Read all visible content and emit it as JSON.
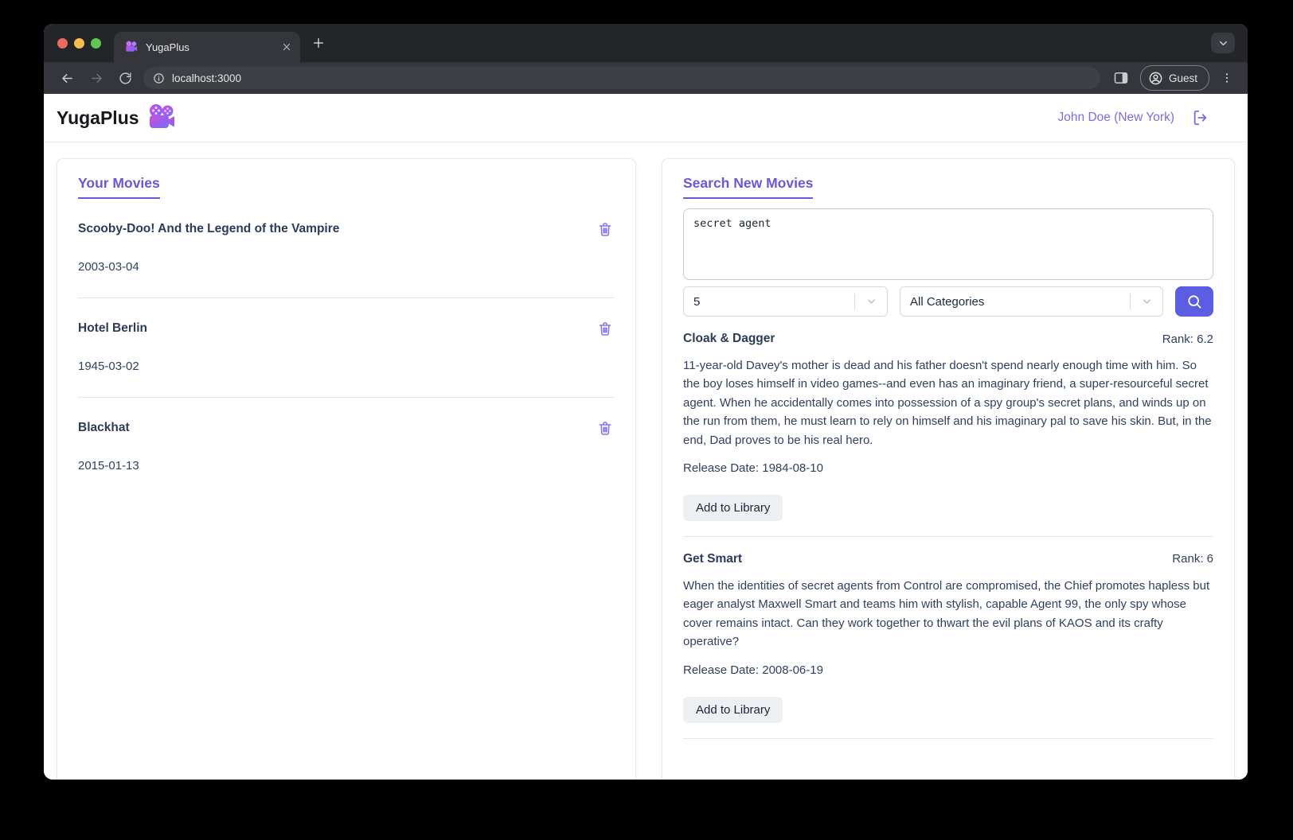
{
  "browser": {
    "tab_title": "YugaPlus",
    "url": "localhost:3000",
    "guest_label": "Guest"
  },
  "header": {
    "brand": "YugaPlus",
    "user": "John Doe (New York)"
  },
  "library": {
    "title": "Your Movies",
    "movies": [
      {
        "title": "Scooby-Doo! And the Legend of the Vampire",
        "date": "2003-03-04"
      },
      {
        "title": "Hotel Berlin",
        "date": "1945-03-02"
      },
      {
        "title": "Blackhat",
        "date": "2015-01-13"
      }
    ]
  },
  "search": {
    "title": "Search New Movies",
    "query": "secret agent",
    "limit": "5",
    "category": "All Categories",
    "results": [
      {
        "title": "Cloak & Dagger",
        "rank": "Rank: 6.2",
        "description": "11-year-old Davey's mother is dead and his father doesn't spend nearly enough time with him. So the boy loses himself in video games--and even has an imaginary friend, a super-resourceful secret agent. When he accidentally comes into possession of a spy group's secret plans, and winds up on the run from them, he must learn to rely on himself and his imaginary pal to save his skin. But, in the end, Dad proves to be his real hero.",
        "release": "Release Date: 1984-08-10",
        "add_label": "Add to Library"
      },
      {
        "title": "Get Smart",
        "rank": "Rank: 6",
        "description": "When the identities of secret agents from Control are compromised, the Chief promotes hapless but eager analyst Maxwell Smart and teams him with stylish, capable Agent 99, the only spy whose cover remains intact. Can they work together to thwart the evil plans of KAOS and its crafty operative?",
        "release": "Release Date: 2008-06-19",
        "add_label": "Add to Library"
      }
    ]
  },
  "icons": {
    "brand_logo": "movie-camera",
    "user_action": "log-out",
    "movie_row_action": "trash",
    "search_submit": "magnifier"
  },
  "colors": {
    "accent_purple": "#6e55d9",
    "trash_purple": "#8577ea",
    "user_link_purple": "#7b6ce6",
    "search_button_indigo": "#5b5de2",
    "text_navy": "#31405f"
  }
}
